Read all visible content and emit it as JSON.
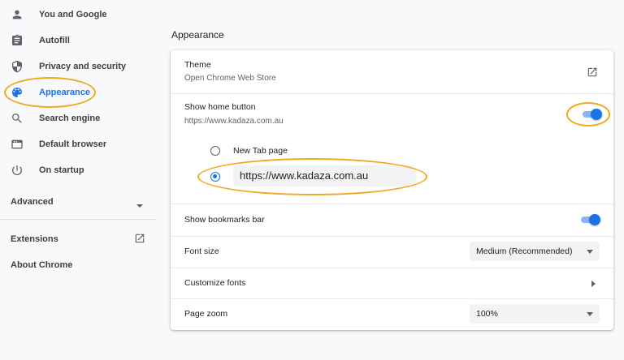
{
  "sidebar": {
    "items": [
      {
        "label": "You and Google",
        "icon": "person-icon"
      },
      {
        "label": "Autofill",
        "icon": "clipboard-icon"
      },
      {
        "label": "Privacy and security",
        "icon": "shield-icon"
      },
      {
        "label": "Appearance",
        "icon": "palette-icon",
        "active": true
      },
      {
        "label": "Search engine",
        "icon": "search-icon"
      },
      {
        "label": "Default browser",
        "icon": "browser-icon"
      },
      {
        "label": "On startup",
        "icon": "power-icon"
      }
    ],
    "advanced_label": "Advanced",
    "extensions_label": "Extensions",
    "about_label": "About Chrome"
  },
  "main": {
    "title": "Appearance",
    "theme": {
      "label": "Theme",
      "sub": "Open Chrome Web Store"
    },
    "home_button": {
      "label": "Show home button",
      "sub": "https://www.kadaza.com.au",
      "enabled": true,
      "option_newtab": "New Tab page",
      "url_value": "https://www.kadaza.com.au"
    },
    "bookmarks": {
      "label": "Show bookmarks bar",
      "enabled": true
    },
    "font_size": {
      "label": "Font size",
      "value": "Medium (Recommended)"
    },
    "customize_fonts": {
      "label": "Customize fonts"
    },
    "page_zoom": {
      "label": "Page zoom",
      "value": "100%"
    }
  },
  "colors": {
    "accent": "#1a73e8",
    "highlight": "#f0a81e"
  }
}
